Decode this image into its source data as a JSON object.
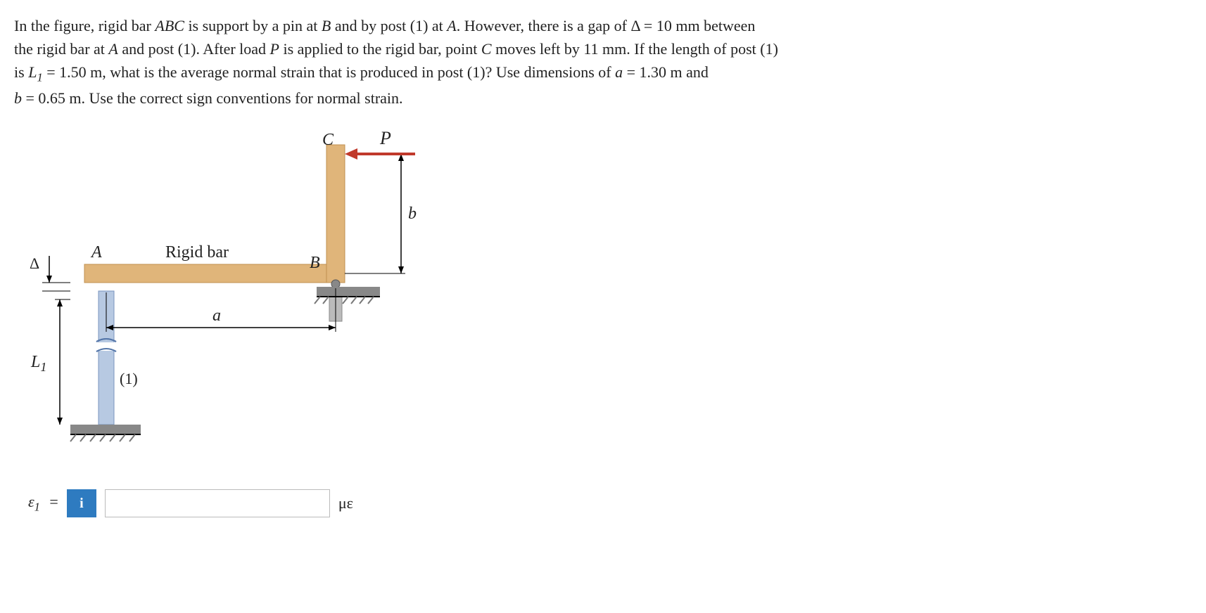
{
  "problem": {
    "line1_a": "In the figure, rigid bar ",
    "abc": "ABC",
    "line1_b": " is support by a pin at ",
    "B": "B",
    "line1_c": " and by post (1) at ",
    "A": "A",
    "line1_d": ". However, there is a gap of Δ = ",
    "gap_val": "10 mm",
    "line1_e": " between",
    "line2_a": "the rigid bar at ",
    "line2_b": " and post (1). After load ",
    "P": "P",
    "line2_c": " is applied to the rigid bar, point ",
    "C": "C",
    "line2_d": " moves left by ",
    "move_val": "11 mm",
    "line2_e": ". If the length of post (1)",
    "line3_a": "is ",
    "L1": "L",
    "L1sub": "1",
    "line3_b": " = ",
    "L1_val": "1.50 m",
    "line3_c": ", what is the average normal strain that is produced in post (1)? Use dimensions of ",
    "a": "a",
    "line3_d": " = ",
    "a_val": "1.30 m",
    "line3_e": " and",
    "line4_a": "",
    "b": "b",
    "line4_b": " = ",
    "b_val": "0.65 m",
    "line4_c": ". Use the correct sign conventions for normal strain."
  },
  "figure": {
    "label_C": "C",
    "label_P": "P",
    "label_b": "b",
    "label_A": "A",
    "label_RigidBar": "Rigid bar",
    "label_B": "B",
    "label_Delta": "Δ",
    "label_a": "a",
    "label_L1": "L",
    "label_L1sub": "1",
    "label_post": "(1)"
  },
  "answer": {
    "epsilon": "ε",
    "sub": "1",
    "equals": "=",
    "info_icon": "i",
    "value": "",
    "unit": "με"
  }
}
